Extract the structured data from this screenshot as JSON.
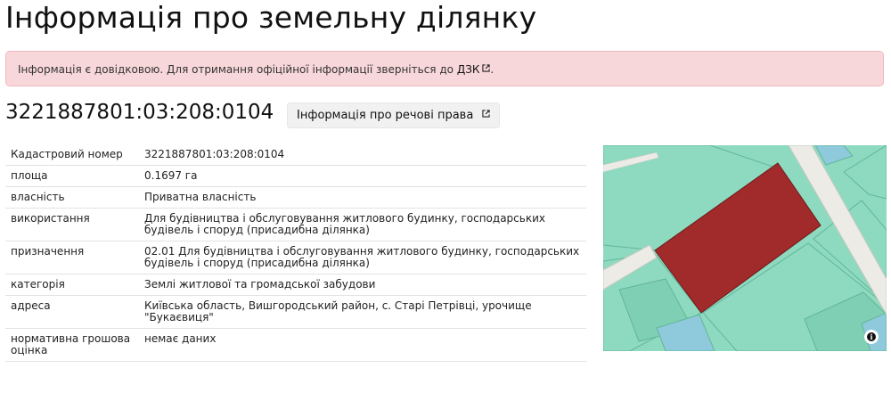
{
  "page": {
    "title": "Інформація про земельну ділянку"
  },
  "alert": {
    "text": "Інформація є довідковою. Для отримання офіційної інформації зверніться до",
    "link_label": "ДЗК",
    "suffix": "."
  },
  "parcel": {
    "cadastral_number": "3221887801:03:208:0104",
    "rights_button_label": "Інформація про речові права"
  },
  "details": [
    {
      "label": "Кадастровий номер",
      "value": "3221887801:03:208:0104"
    },
    {
      "label": "площа",
      "value": "0.1697 га"
    },
    {
      "label": "власність",
      "value": "Приватна власність"
    },
    {
      "label": "використання",
      "value": "Для будівництва і обслуговування житлового будинку, господарських будівель і споруд (присадибна ділянка)"
    },
    {
      "label": "призначення",
      "value": "02.01 Для будівництва і обслуговування житлового будинку, господарських будівель і споруд (присадибна ділянка)"
    },
    {
      "label": "категорія",
      "value": "Землі житлової та громадської забудови"
    },
    {
      "label": "адреса",
      "value": "Київська область, Вишгородський район, с. Старі Петрівці, урочище \"Букаєвиця\""
    },
    {
      "label": "нормативна грошова оцінка",
      "value": "немає даних"
    }
  ],
  "map": {
    "colors": {
      "parcel_fill": "#a12a2a",
      "neighbor_fill": "#8ddac1",
      "neighbor_border": "#63b697",
      "water_fill": "#8ec9dc",
      "road_fill": "#ecebe6",
      "road_edge": "#c9c9c2"
    },
    "info_icon": "info-icon"
  }
}
